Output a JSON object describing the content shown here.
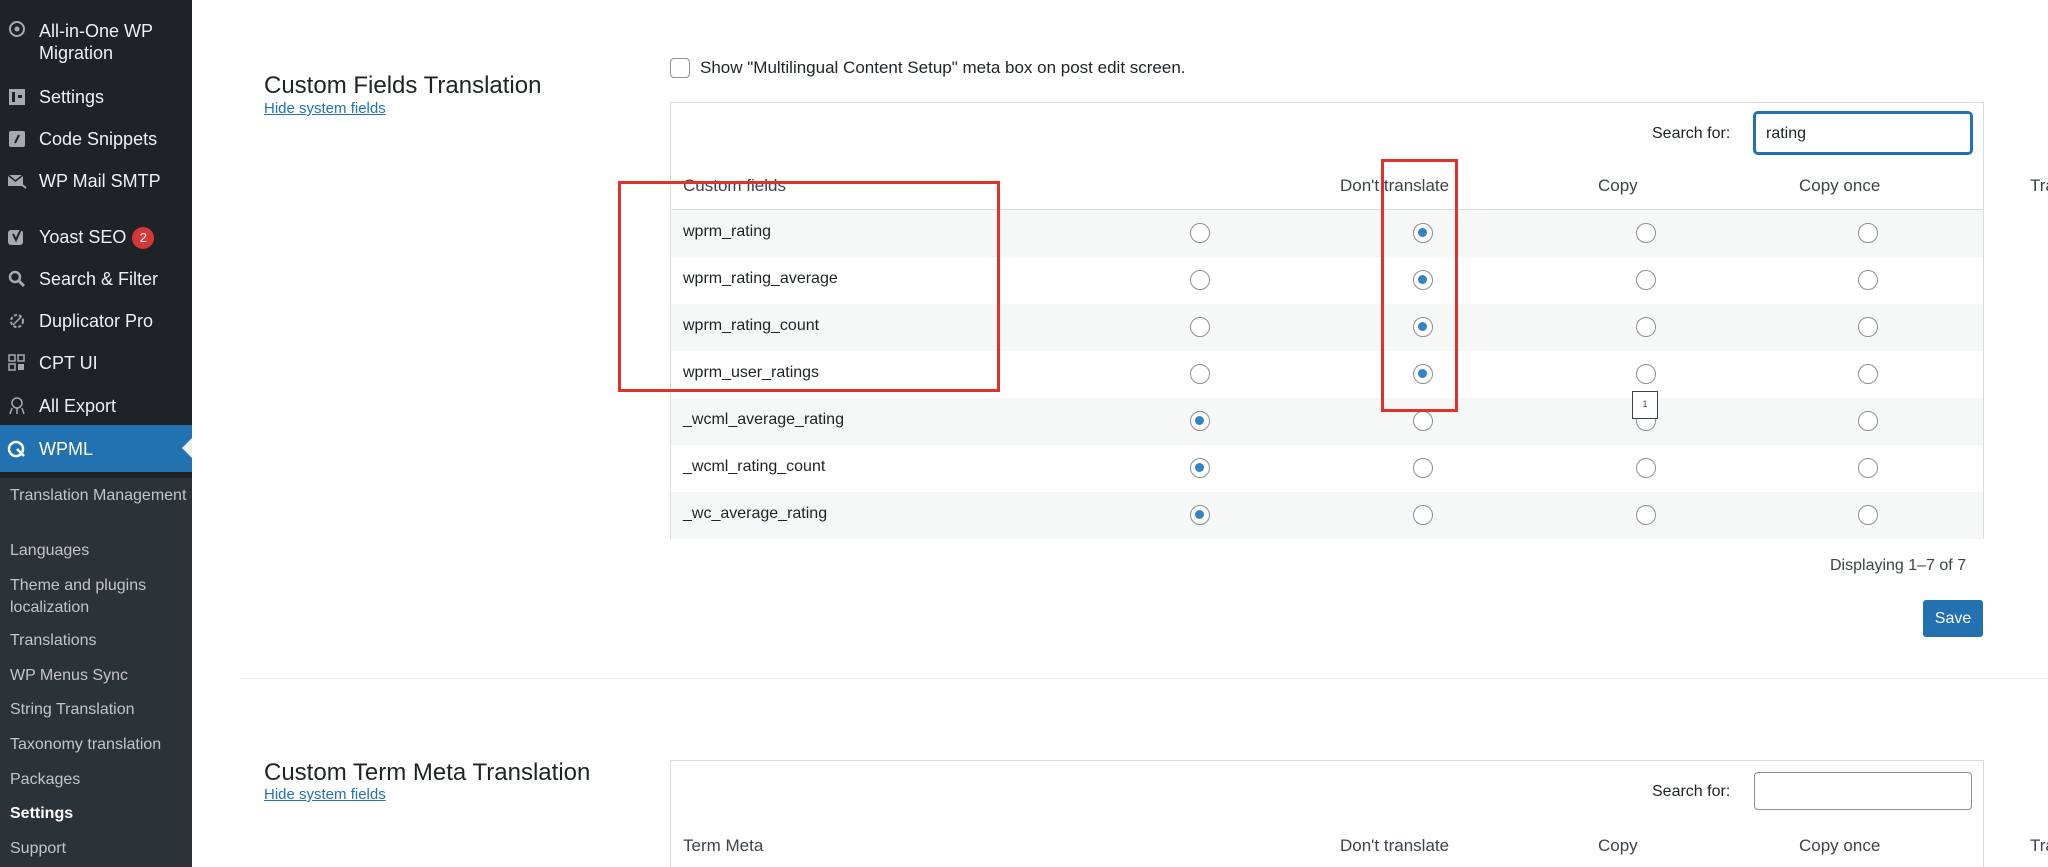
{
  "sidebar": {
    "items": [
      {
        "label": "All-in-One WP Migration",
        "icon": "migration-icon"
      },
      {
        "label": "Settings",
        "icon": "settings-icon"
      },
      {
        "label": "Code Snippets",
        "icon": "code-icon"
      },
      {
        "label": "WP Mail SMTP",
        "icon": "mail-icon"
      },
      {
        "label": "Yoast SEO",
        "icon": "yoast-icon",
        "badge": "2"
      },
      {
        "label": "Search & Filter",
        "icon": "search-icon"
      },
      {
        "label": "Duplicator Pro",
        "icon": "gear-icon"
      },
      {
        "label": "CPT UI",
        "icon": "grid-icon"
      },
      {
        "label": "All Export",
        "icon": "export-icon"
      },
      {
        "label": "WPML",
        "icon": "wpml-icon",
        "active": true
      }
    ],
    "submenu": [
      "Translation Management",
      "Languages",
      "Theme and plugins localization",
      "Translations",
      "WP Menus Sync",
      "String Translation",
      "Taxonomy translation",
      "Packages",
      "Settings",
      "Support"
    ],
    "current_submenu": "Settings"
  },
  "custom_fields": {
    "title": "Custom Fields Translation",
    "hide_link": "Hide system fields",
    "meta_box_label": "Show \"Multilingual Content Setup\" meta box on post edit screen.",
    "meta_box_checked": false,
    "search_label": "Search for:",
    "search_value": "rating",
    "columns": [
      "Custom fields",
      "Don't translate",
      "Copy",
      "Copy once",
      "Translate"
    ],
    "rows": [
      {
        "name": "wprm_rating",
        "selected": "Copy"
      },
      {
        "name": "wprm_rating_average",
        "selected": "Copy"
      },
      {
        "name": "wprm_rating_count",
        "selected": "Copy"
      },
      {
        "name": "wprm_user_ratings",
        "selected": "Copy"
      },
      {
        "name": "_wcml_average_rating",
        "selected": "Don't translate"
      },
      {
        "name": "_wcml_rating_count",
        "selected": "Don't translate"
      },
      {
        "name": "_wc_average_rating",
        "selected": "Don't translate"
      }
    ],
    "displaying": "Displaying 1–7 of 7",
    "save_label": "Save"
  },
  "term_meta": {
    "title": "Custom Term Meta Translation",
    "hide_link": "Hide system fields",
    "search_label": "Search for:",
    "search_value": "",
    "columns": [
      "Term Meta",
      "Don't translate",
      "Copy",
      "Copy once",
      "Translate"
    ]
  },
  "colors": {
    "sidebar_bg": "#1d2327",
    "accent": "#2271b1",
    "highlight_box": "#e0312b",
    "radio_checked": "#3582c4"
  }
}
